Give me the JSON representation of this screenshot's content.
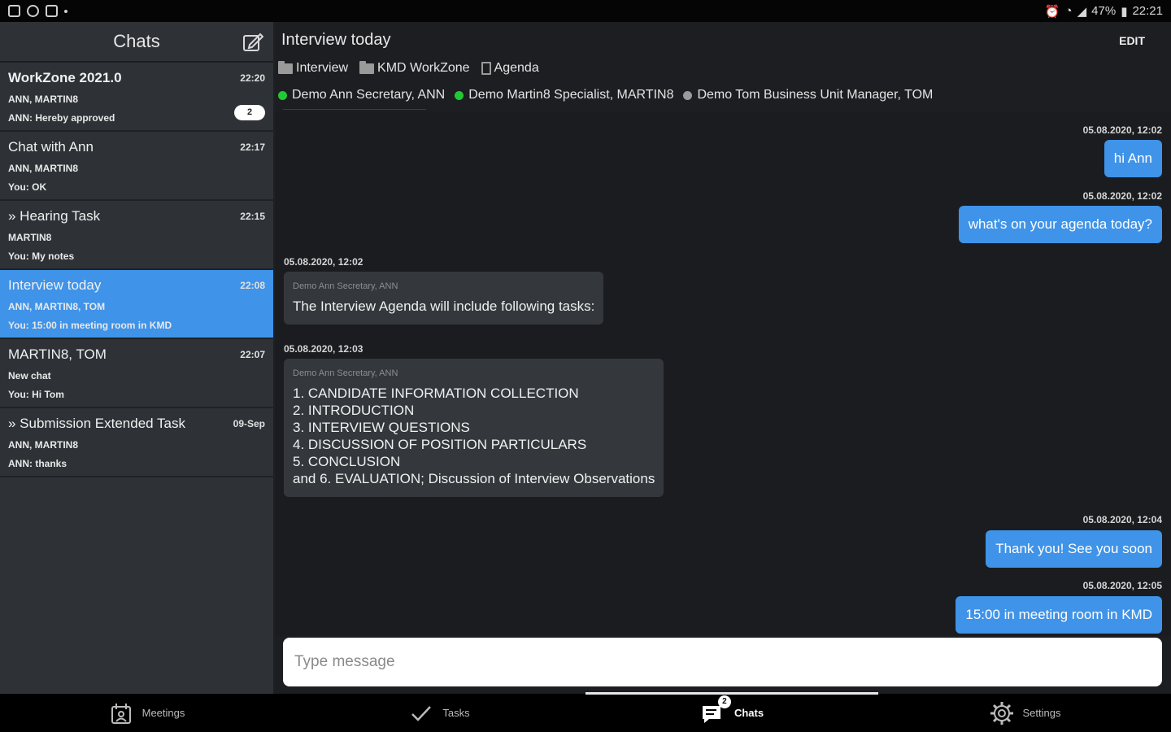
{
  "status_bar": {
    "battery": "47%",
    "time": "22:21"
  },
  "sidebar": {
    "title": "Chats",
    "chats": [
      {
        "name": "WorkZone 2021.0",
        "time": "22:20",
        "members": "ANN, MARTIN8",
        "preview": "ANN: Hereby approved",
        "unread": "2"
      },
      {
        "name": "Chat with Ann",
        "time": "22:17",
        "members": "ANN, MARTIN8",
        "preview": "You: OK"
      },
      {
        "name": "» Hearing Task",
        "time": "22:15",
        "members": "MARTIN8",
        "preview": "You: My notes"
      },
      {
        "name": "Interview today",
        "time": "22:08",
        "members": "ANN, MARTIN8, TOM",
        "preview": "You: 15:00 in meeting room in KMD",
        "active": true
      },
      {
        "name": "MARTIN8, TOM",
        "time": "22:07",
        "members": "New chat",
        "preview": "You: Hi Tom"
      },
      {
        "name": "» Submission Extended Task",
        "time": "09-Sep",
        "members": "ANN, MARTIN8",
        "preview": "ANN: thanks"
      }
    ]
  },
  "main": {
    "title": "Interview today",
    "edit_label": "EDIT",
    "folders": [
      "Interview",
      "KMD WorkZone",
      "Agenda"
    ],
    "participants": [
      {
        "name": "Demo Ann Secretary, ANN",
        "color": "#22c832"
      },
      {
        "name": "Demo Martin8 Specialist, MARTIN8",
        "color": "#22c832"
      },
      {
        "name": "Demo Tom Business Unit Manager, TOM",
        "color": "#9a9a9a"
      }
    ],
    "messages": [
      {
        "ts": "05.08.2020, 12:02",
        "dir": "out",
        "text": "hi Ann"
      },
      {
        "ts": "05.08.2020, 12:02",
        "dir": "out",
        "text": "what's on your agenda today?"
      },
      {
        "ts": "05.08.2020, 12:02",
        "dir": "in",
        "sender": "Demo Ann Secretary, ANN",
        "lines": [
          "The Interview Agenda will include following tasks:"
        ]
      },
      {
        "ts": "05.08.2020, 12:03",
        "dir": "in",
        "sender": "Demo Ann Secretary, ANN",
        "lines": [
          "1. CANDIDATE INFORMATION COLLECTION",
          "2. INTRODUCTION",
          "3. INTERVIEW QUESTIONS",
          "4. DISCUSSION OF POSITION PARTICULARS",
          "5. CONCLUSION",
          "and 6. EVALUATION; Discussion of Interview Observations"
        ]
      },
      {
        "ts": "05.08.2020, 12:04",
        "dir": "out",
        "text": "Thank you! See you soon"
      },
      {
        "ts": "05.08.2020, 12:05",
        "dir": "out",
        "text": "15:00 in meeting room in KMD"
      }
    ],
    "composer_placeholder": "Type message"
  },
  "bottom_nav": [
    {
      "label": "Meetings",
      "icon": "meetings-icon"
    },
    {
      "label": "Tasks",
      "icon": "checkmark-icon"
    },
    {
      "label": "Chats",
      "icon": "chat-icon",
      "active": true,
      "badge": "2"
    },
    {
      "label": "Settings",
      "icon": "gear-icon"
    }
  ]
}
